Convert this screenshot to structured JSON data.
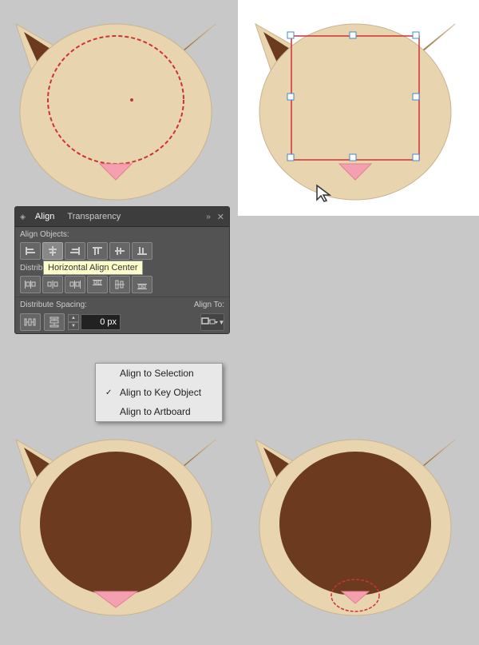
{
  "panel": {
    "title": "Align",
    "tab2": "Transparency",
    "align_objects_label": "Align Objects:",
    "distribute_objects_label": "Distribute Objects:",
    "distribute_spacing_label": "Distribute Spacing:",
    "align_to_label": "Align To:",
    "spacing_value": "0 px",
    "tooltip_text": "Horizontal Align Center"
  },
  "dropdown": {
    "items": [
      {
        "label": "Align to Selection",
        "checked": false
      },
      {
        "label": "Align to Key Object",
        "checked": true
      },
      {
        "label": "Align to Artboard",
        "checked": false
      }
    ]
  },
  "colors": {
    "cat_body": "#e8d5b0",
    "cat_dark": "#6b3a1f",
    "cat_nose": "#f4a0b0",
    "outline_red": "#cc3333",
    "selection_blue": "#4488cc",
    "canvas_white": "#ffffff"
  }
}
